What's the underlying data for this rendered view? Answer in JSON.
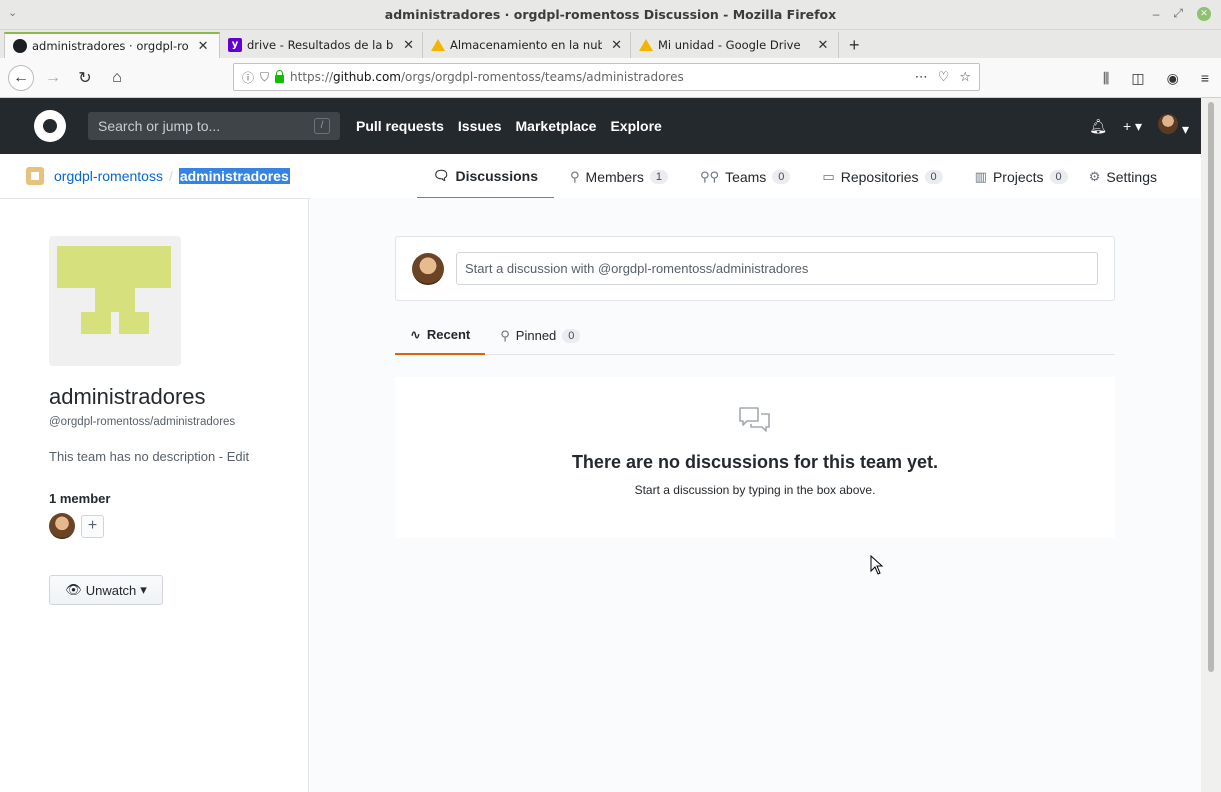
{
  "window": {
    "title": "administradores · orgdpl-romentoss Discussion - Mozilla Firefox"
  },
  "tabs": [
    {
      "label": "administradores · orgdpl-ro",
      "active": true
    },
    {
      "label": "drive - Resultados de la bús",
      "active": false
    },
    {
      "label": "Almacenamiento en la nub",
      "active": false
    },
    {
      "label": "Mi unidad - Google Drive",
      "active": false
    }
  ],
  "urlbar": {
    "host_prefix": "https://",
    "host": "github.com",
    "path": "/orgs/orgdpl-romentoss/teams/administradores"
  },
  "github": {
    "search_placeholder": "Search or jump to...",
    "search_shortcut": "/",
    "nav": [
      "Pull requests",
      "Issues",
      "Marketplace",
      "Explore"
    ]
  },
  "breadcrumb": {
    "org": "orgdpl-romentoss",
    "separator": "/",
    "team": "administradores"
  },
  "team_tabs": [
    {
      "label": "Discussions",
      "count": null,
      "active": true
    },
    {
      "label": "Members",
      "count": "1",
      "active": false
    },
    {
      "label": "Teams",
      "count": "0",
      "active": false
    },
    {
      "label": "Repositories",
      "count": "0",
      "active": false
    },
    {
      "label": "Projects",
      "count": "0",
      "active": false
    }
  ],
  "settings_label": "Settings",
  "sidebar": {
    "team_name": "administradores",
    "team_slug": "@orgdpl-romentoss/administradores",
    "description": "This team has no description - ",
    "edit_label": "Edit",
    "members_label": "1 member",
    "unwatch_label": "Unwatch"
  },
  "composer": {
    "placeholder": "Start a discussion with @orgdpl-romentoss/administradores"
  },
  "discussion_tabs": [
    {
      "label": "Recent",
      "active": true
    },
    {
      "label": "Pinned",
      "count": "0",
      "active": false
    }
  ],
  "blankslate": {
    "title": "There are no discussions for this team yet.",
    "subtitle": "Start a discussion by typing in the box above."
  },
  "colors": {
    "accent_tab": "#e36209",
    "header_bg": "#24292e",
    "link": "#0366d6",
    "avatar_fill": "#d6e07d"
  }
}
